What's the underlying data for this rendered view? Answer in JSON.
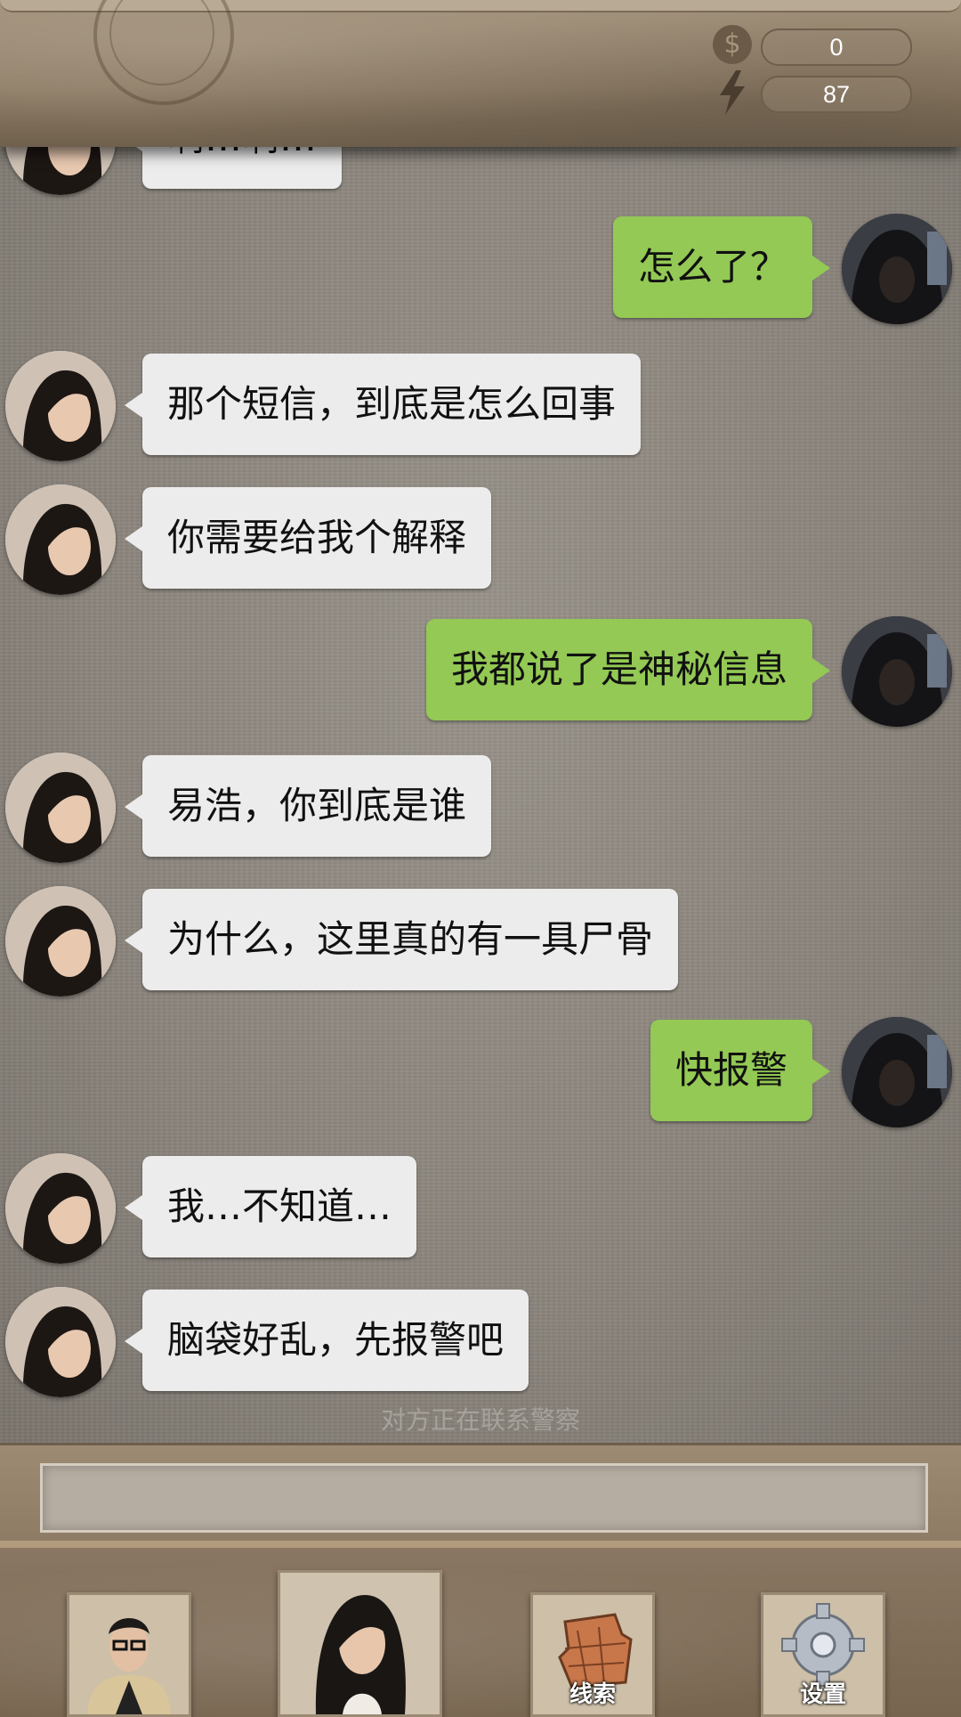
{
  "header": {
    "coins": "0",
    "energy": "87",
    "coin_icon": "$"
  },
  "messages": [
    {
      "side": "in",
      "text": "啊…啊…"
    },
    {
      "side": "out",
      "text": "怎么了？"
    },
    {
      "side": "in",
      "text": "那个短信，到底是怎么回事"
    },
    {
      "side": "in",
      "text": "你需要给我个解释"
    },
    {
      "side": "out",
      "text": "我都说了是神秘信息"
    },
    {
      "side": "in",
      "text": "易浩，你到底是谁"
    },
    {
      "side": "in",
      "text": "为什么，这里真的有一具尸骨"
    },
    {
      "side": "out",
      "text": "快报警"
    },
    {
      "side": "in",
      "text": "我…不知道…"
    },
    {
      "side": "in",
      "text": "脑袋好乱，先报警吧"
    }
  ],
  "status": "对方正在联系警察",
  "nav": {
    "clues_label": "线索",
    "settings_label": "设置"
  },
  "colors": {
    "outgoing_bubble": "#93c954",
    "incoming_bubble": "#ececec"
  }
}
